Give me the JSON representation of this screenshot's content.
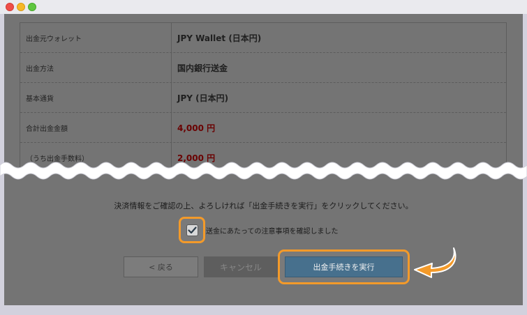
{
  "table": {
    "rows": [
      {
        "label": "出金元ウォレット",
        "value": "JPY Wallet (日本円)"
      },
      {
        "label": "出金方法",
        "value": "国内銀行送金"
      },
      {
        "label": "基本通貨",
        "value": "JPY (日本円)"
      },
      {
        "label": "合計出金金額",
        "value": "4,000 円"
      },
      {
        "label": "（うち出金手数料）",
        "value": "2,000 円"
      }
    ]
  },
  "instruction": "決済情報をご確認の上、よろしければ「出金手続きを実行」をクリックしてください。",
  "confirm_checkbox": {
    "label": "送金にあたっての注意事項を確認しました",
    "checked": true
  },
  "buttons": {
    "back": "< 戻る",
    "cancel": "キャンセル",
    "submit": "出金手続きを実行"
  },
  "colors": {
    "highlight": "#f39a2a",
    "submit": "#47708d",
    "amount_red": "#6a0000"
  }
}
